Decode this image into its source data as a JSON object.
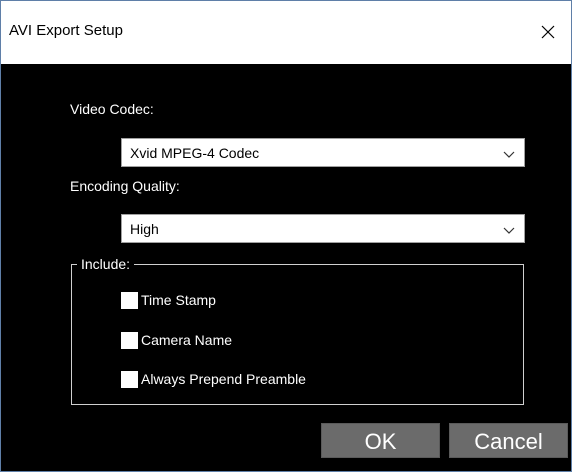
{
  "window": {
    "title": "AVI Export Setup",
    "close_icon": "close-icon"
  },
  "video_codec": {
    "label": "Video Codec:",
    "value": "Xvid MPEG-4 Codec"
  },
  "encoding_quality": {
    "label": "Encoding Quality:",
    "value": "High"
  },
  "include_group": {
    "legend": "Include:",
    "options": [
      {
        "label": "Time Stamp",
        "checked": false
      },
      {
        "label": "Camera Name",
        "checked": false
      },
      {
        "label": "Always Prepend Preamble",
        "checked": false
      }
    ]
  },
  "buttons": {
    "ok_label": "OK",
    "cancel_label": "Cancel"
  },
  "colors": {
    "background": "#000000",
    "titlebar": "#ffffff",
    "button": "#6b6b6b",
    "frame_border": "#5f7fa8"
  }
}
